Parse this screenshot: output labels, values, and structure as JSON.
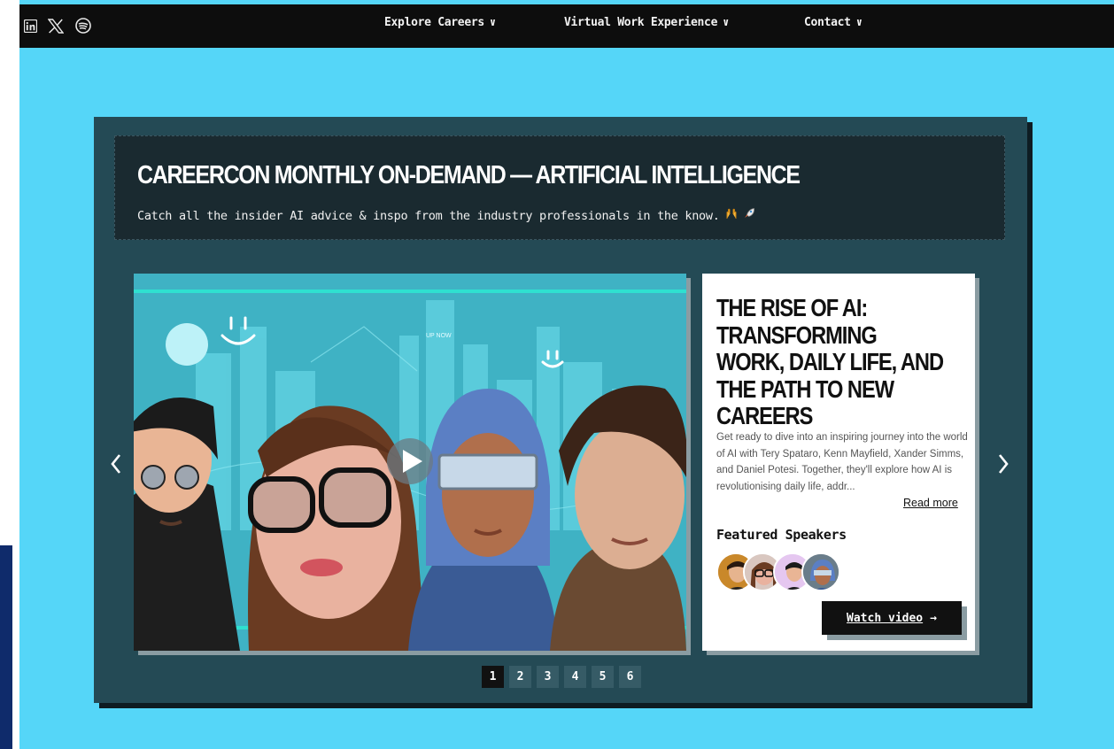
{
  "social": {
    "icons": [
      "linkedin-icon",
      "x-icon",
      "spotify-icon"
    ]
  },
  "nav": {
    "items": [
      {
        "label": "Explore Careers"
      },
      {
        "label": "Virtual Work Experience"
      },
      {
        "label": "Contact"
      }
    ]
  },
  "section": {
    "title": "CAREERCON MONTHLY ON-DEMAND — ARTIFICIAL INTELLIGENCE",
    "subtitle": "Catch all the insider AI advice & inspo from the industry professionals in the know."
  },
  "carousel": {
    "video_sign_text": "UP NOW",
    "card": {
      "title": "THE RISE OF AI: TRANSFORMING WORK, DAILY LIFE, AND THE PATH TO NEW CAREERS",
      "description": "Get ready to dive into an inspiring journey into the world of AI with Tery Spataro, Kenn Mayfield, Xander Simms, and Daniel Potesi. Together, they'll explore how AI is revolutionising daily life, addr...",
      "read_more": "Read more",
      "featured_label": "Featured Speakers",
      "watch_label": "Watch video",
      "watch_arrow": "→"
    },
    "pages": [
      "1",
      "2",
      "3",
      "4",
      "5",
      "6"
    ],
    "active_page": "1"
  },
  "colors": {
    "page_bg": "#55d6f8",
    "panel": "#244a55",
    "topbar": "#0d0d0d",
    "accent_line": "#2fe0d0"
  }
}
